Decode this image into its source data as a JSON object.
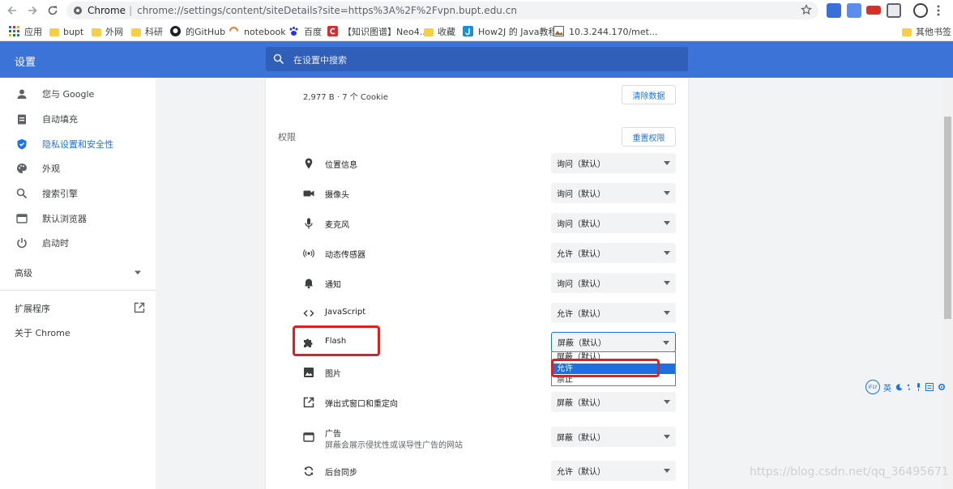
{
  "browser": {
    "omnibox": {
      "scheme_label": "Chrome",
      "separator": "|",
      "url": "chrome://settings/content/siteDetails?site=https%3A%2F%2Fvpn.bupt.edu.cn"
    },
    "bookmarks": [
      {
        "label": "应用",
        "icon": "apps-grid-icon"
      },
      {
        "label": "bupt",
        "icon": "folder-icon"
      },
      {
        "label": "外网",
        "icon": "folder-icon"
      },
      {
        "label": "科研",
        "icon": "folder-icon"
      },
      {
        "label": "的GitHub",
        "icon": "github-icon"
      },
      {
        "label": "notebook",
        "icon": "notebook-icon"
      },
      {
        "label": "百度",
        "icon": "baidu-paw-icon"
      },
      {
        "label": "【知识图谱】Neo4...",
        "icon": "csdn-c-icon"
      },
      {
        "label": "收藏",
        "icon": "folder-icon"
      },
      {
        "label": "How2J 的 Java教程",
        "icon": "how2j-icon"
      },
      {
        "label": "10.3.244.170/met...",
        "icon": "image-page-icon"
      },
      {
        "label": "其他书签",
        "icon": "folder-icon"
      }
    ]
  },
  "settings": {
    "title": "设置",
    "search_placeholder": "在设置中搜索",
    "sidebar": {
      "items": [
        {
          "label": "您与 Google",
          "icon": "person-icon"
        },
        {
          "label": "自动填充",
          "icon": "clipboard-icon"
        },
        {
          "label": "隐私设置和安全性",
          "icon": "shield-icon"
        },
        {
          "label": "外观",
          "icon": "palette-icon"
        },
        {
          "label": "搜索引擎",
          "icon": "search-icon"
        },
        {
          "label": "默认浏览器",
          "icon": "browser-window-icon"
        },
        {
          "label": "启动时",
          "icon": "power-icon"
        }
      ],
      "advanced": "高级",
      "extensions": "扩展程序",
      "about": "关于 Chrome"
    },
    "main": {
      "usage": "2,977 B · 7 个 Cookie",
      "clear_button": "清除数据",
      "permissions_heading": "权限",
      "reset_button": "重置权限",
      "permissions": [
        {
          "label": "位置信息",
          "value": "询问（默认）",
          "icon": "location-pin-icon"
        },
        {
          "label": "摄像头",
          "value": "询问（默认）",
          "icon": "camera-icon"
        },
        {
          "label": "麦克风",
          "value": "询问（默认）",
          "icon": "microphone-icon"
        },
        {
          "label": "动态传感器",
          "value": "允许（默认）",
          "icon": "sensors-icon"
        },
        {
          "label": "通知",
          "value": "询问（默认）",
          "icon": "bell-icon"
        },
        {
          "label": "JavaScript",
          "value": "允许（默认）",
          "icon": "code-icon"
        },
        {
          "label": "Flash",
          "value": "屏蔽（默认）",
          "icon": "puzzle-icon"
        },
        {
          "label": "图片",
          "value": "",
          "icon": "image-icon"
        },
        {
          "label": "弹出式窗口和重定向",
          "value": "屏蔽（默认）",
          "icon": "open-in-new-icon"
        },
        {
          "label": "广告",
          "sublabel": "屏蔽会展示侵扰性或误导性广告的网站",
          "value": "屏蔽（默认）",
          "icon": "ad-frame-icon"
        },
        {
          "label": "后台同步",
          "value": "允许（默认）",
          "icon": "sync-icon"
        }
      ],
      "flash_dropdown": {
        "options": [
          "屏蔽（默认）",
          "允许",
          "禁止"
        ],
        "highlighted": "允许"
      }
    }
  },
  "ifly": {
    "logo": "iFLY",
    "text": "英"
  },
  "watermark": "https://blog.csdn.net/qq_36495671",
  "colors": {
    "header": "#3b73d7",
    "accent": "#1a73e8",
    "annotation": "#e02020"
  }
}
